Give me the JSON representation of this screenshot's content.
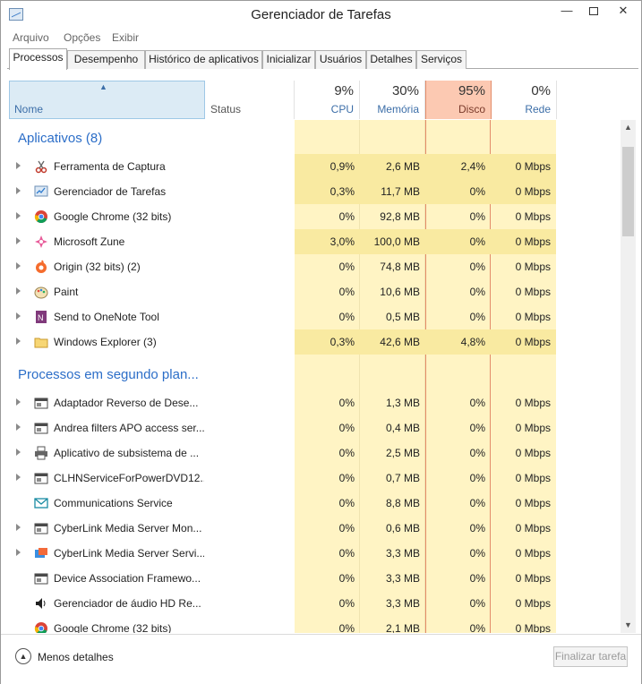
{
  "window": {
    "title": "Gerenciador de Tarefas"
  },
  "menu": [
    "Arquivo",
    "Opções",
    "Exibir"
  ],
  "tabs": [
    "Processos",
    "Desempenho",
    "Histórico de aplicativos",
    "Inicializar",
    "Usuários",
    "Detalhes",
    "Serviços"
  ],
  "active_tab": "Processos",
  "columns": {
    "name": "Nome",
    "status": "Status",
    "cpu": {
      "pct": "9%",
      "label": "CPU"
    },
    "memory": {
      "pct": "30%",
      "label": "Memória"
    },
    "disk": {
      "pct": "95%",
      "label": "Disco"
    },
    "network": {
      "pct": "0%",
      "label": "Rede"
    }
  },
  "colors": {
    "heat_light": "#fff4c4",
    "heat_medium": "#ffeaa0",
    "heat_row": "#f9eaa1",
    "disk_header": "#fcc9b2",
    "group_text": "#2c6ec8"
  },
  "groups": [
    {
      "title": "Aplicativos (8)",
      "rows": [
        {
          "name": "Ferramenta de Captura",
          "icon": "scissors-icon",
          "cpu": "0,9%",
          "mem": "2,6 MB",
          "disk": "2,4%",
          "net": "0 Mbps",
          "expandable": true,
          "heat": true
        },
        {
          "name": "Gerenciador de Tarefas",
          "icon": "task-manager-icon",
          "cpu": "0,3%",
          "mem": "11,7 MB",
          "disk": "0%",
          "net": "0 Mbps",
          "expandable": true,
          "heat": true
        },
        {
          "name": "Google Chrome (32 bits)",
          "icon": "chrome-icon",
          "cpu": "0%",
          "mem": "92,8 MB",
          "disk": "0%",
          "net": "0 Mbps",
          "expandable": true,
          "heat": false
        },
        {
          "name": "Microsoft Zune",
          "icon": "zune-icon",
          "cpu": "3,0%",
          "mem": "100,0 MB",
          "disk": "0%",
          "net": "0 Mbps",
          "expandable": true,
          "heat": true
        },
        {
          "name": "Origin (32 bits) (2)",
          "icon": "origin-icon",
          "cpu": "0%",
          "mem": "74,8 MB",
          "disk": "0%",
          "net": "0 Mbps",
          "expandable": true,
          "heat": false
        },
        {
          "name": "Paint",
          "icon": "paint-icon",
          "cpu": "0%",
          "mem": "10,6 MB",
          "disk": "0%",
          "net": "0 Mbps",
          "expandable": true,
          "heat": false
        },
        {
          "name": "Send to OneNote Tool",
          "icon": "onenote-icon",
          "cpu": "0%",
          "mem": "0,5 MB",
          "disk": "0%",
          "net": "0 Mbps",
          "expandable": true,
          "heat": false
        },
        {
          "name": "Windows Explorer (3)",
          "icon": "folder-icon",
          "cpu": "0,3%",
          "mem": "42,6 MB",
          "disk": "4,8%",
          "net": "0 Mbps",
          "expandable": true,
          "heat": true
        }
      ]
    },
    {
      "title": "Processos em segundo plan...",
      "rows": [
        {
          "name": "Adaptador Reverso de Dese...",
          "icon": "service-window-icon",
          "cpu": "0%",
          "mem": "1,3 MB",
          "disk": "0%",
          "net": "0 Mbps",
          "expandable": true,
          "heat": false
        },
        {
          "name": "Andrea filters APO access ser...",
          "icon": "service-window-icon",
          "cpu": "0%",
          "mem": "0,4 MB",
          "disk": "0%",
          "net": "0 Mbps",
          "expandable": true,
          "heat": false
        },
        {
          "name": "Aplicativo de subsistema de ...",
          "icon": "printer-icon",
          "cpu": "0%",
          "mem": "2,5 MB",
          "disk": "0%",
          "net": "0 Mbps",
          "expandable": true,
          "heat": false
        },
        {
          "name": "CLHNServiceForPowerDVD12...",
          "icon": "service-window-icon",
          "cpu": "0%",
          "mem": "0,7 MB",
          "disk": "0%",
          "net": "0 Mbps",
          "expandable": true,
          "heat": false
        },
        {
          "name": "Communications Service",
          "icon": "mail-icon",
          "cpu": "0%",
          "mem": "8,8 MB",
          "disk": "0%",
          "net": "0 Mbps",
          "expandable": false,
          "heat": false
        },
        {
          "name": "CyberLink Media Server Mon...",
          "icon": "service-window-icon",
          "cpu": "0%",
          "mem": "0,6 MB",
          "disk": "0%",
          "net": "0 Mbps",
          "expandable": true,
          "heat": false
        },
        {
          "name": "CyberLink Media Server Servi...",
          "icon": "cyberlink-icon",
          "cpu": "0%",
          "mem": "3,3 MB",
          "disk": "0%",
          "net": "0 Mbps",
          "expandable": true,
          "heat": false
        },
        {
          "name": "Device Association Framewo...",
          "icon": "service-window-icon",
          "cpu": "0%",
          "mem": "3,3 MB",
          "disk": "0%",
          "net": "0 Mbps",
          "expandable": false,
          "heat": false
        },
        {
          "name": "Gerenciador de áudio HD Re...",
          "icon": "speaker-icon",
          "cpu": "0%",
          "mem": "3,3 MB",
          "disk": "0%",
          "net": "0 Mbps",
          "expandable": false,
          "heat": false
        },
        {
          "name": "Google Chrome (32 bits)",
          "icon": "chrome-icon",
          "cpu": "0%",
          "mem": "2,1 MB",
          "disk": "0%",
          "net": "0 Mbps",
          "expandable": false,
          "heat": false
        }
      ]
    }
  ],
  "footer": {
    "less_details": "Menos detalhes",
    "end_task": "Finalizar tarefa"
  }
}
